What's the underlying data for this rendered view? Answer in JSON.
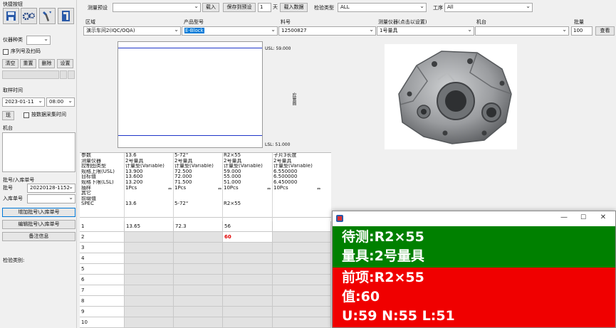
{
  "colors": {
    "popup_green": "#008000",
    "popup_red": "#f00000",
    "limit_line": "#1f35c8",
    "highlight": "#0078d7"
  },
  "left": {
    "quick_title": "快捷按钮",
    "tools": [
      "save-icon",
      "gears-icon",
      "wrench-icon",
      "exit-icon"
    ],
    "instrument_type_label": "仪器种类",
    "instrument_type_value": "",
    "serial_scan_label": "序列号及扫码",
    "btn_clear": "清空",
    "btn_reset": "重置",
    "btn_delete": "删除",
    "btn_settings": "设置",
    "sample_time_label": "取样时间",
    "date": "2023-01-11",
    "time": "08:00",
    "btn_now": "现",
    "by_collect_time": "按数据采集时间",
    "machine_label": "机台",
    "batch_header": "批号/入库单号",
    "batch_label": "批号",
    "batch_value": "20220128-1152",
    "warehouse_label": "入库单号",
    "warehouse_value": "",
    "btn_add_batch": "增加批号\\入库单号",
    "btn_edit_batch": "编辑批号\\入库单号",
    "btn_remarks": "备注信息",
    "inspect_type_label": "检验类别:"
  },
  "top": {
    "preset_label": "测量预设",
    "preset_value": "",
    "btn_load": "载入",
    "btn_save_preset": "保存到预设",
    "days_value": "1",
    "days_unit": "天",
    "btn_load_data": "载入数据",
    "check_type_label": "检验类型",
    "check_type_value": "ALL",
    "process_label": "工序",
    "process_value": "All",
    "area_label": "区域",
    "area_value": "演示车间2(IQC/OQA)",
    "product_label": "产品型号",
    "product_value": "E-Block",
    "material_label": "料号",
    "material_value": "12500827",
    "instrument_label": "测量仪器(点击以设置)",
    "instrument_value": "1号量具",
    "machine_label": "机台",
    "machine_value": "",
    "qty_label": "批量",
    "qty_value": "100",
    "btn_query": "查看"
  },
  "chart": {
    "usl_label": "USL: 59.000",
    "lsl_label": "LSL: 51.000",
    "side_label": "应管图"
  },
  "grid": {
    "row_headers": [
      "参数",
      "测量仪器",
      "控制图类型",
      "规格上限(USL)",
      "目标值",
      "规格下限(LSL)",
      "抽样",
      "其它",
      "前缀值",
      "SPEC"
    ],
    "columns": [
      {
        "lines": [
          "13.6",
          "2号量具",
          "计量型(Variable)",
          "13.900",
          "13.600",
          "13.200",
          "1Pcs",
          "",
          "",
          "13.6"
        ]
      },
      {
        "lines": [
          "5-72°",
          "2号量具",
          "计量型(Variable)",
          "72.500",
          "72.000",
          "71.500",
          "1Pcs",
          "",
          "",
          "5-72°"
        ]
      },
      {
        "lines": [
          "R2×55",
          "2号量具",
          "计量型(Variable)",
          "59.000",
          "55.000",
          "51.000",
          "10Pcs",
          "",
          "",
          "R2×55"
        ]
      },
      {
        "lines": [
          "子片3长度",
          "2号量具",
          "计量型(Variable)",
          "6.550000",
          "6.500000",
          "6.450000",
          "10Pcs",
          "",
          "",
          ""
        ]
      }
    ],
    "rows": [
      {
        "num": "1",
        "v": [
          "13.65",
          "72.3",
          "56",
          ""
        ]
      },
      {
        "num": "2",
        "v": [
          "",
          "",
          "60",
          ""
        ]
      },
      {
        "num": "3",
        "v": [
          "",
          "",
          "",
          ""
        ]
      },
      {
        "num": "4",
        "v": [
          "",
          "",
          "",
          ""
        ]
      },
      {
        "num": "5",
        "v": [
          "",
          "",
          "",
          ""
        ]
      },
      {
        "num": "6",
        "v": [
          "",
          "",
          "",
          ""
        ]
      },
      {
        "num": "7",
        "v": [
          "",
          "",
          "",
          ""
        ]
      },
      {
        "num": "8",
        "v": [
          "",
          "",
          "",
          ""
        ]
      },
      {
        "num": "9",
        "v": [
          "",
          "",
          "",
          ""
        ]
      },
      {
        "num": "10",
        "v": [
          "",
          "",
          "",
          ""
        ]
      }
    ]
  },
  "popup": {
    "title": "",
    "pending": "待测:R2×55",
    "gauge": "量具:2号量具",
    "prev_item": "前项:R2×55",
    "value": "值:60",
    "limits": "U:59 N:55 L:51"
  }
}
